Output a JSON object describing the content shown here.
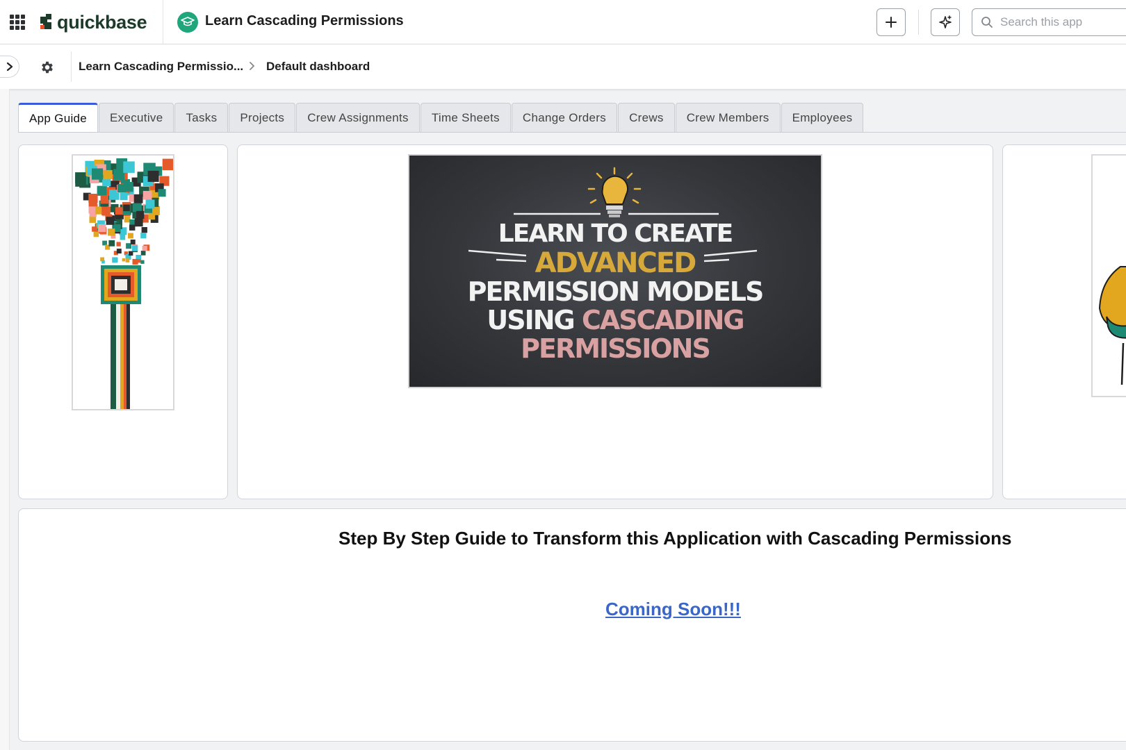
{
  "header": {
    "logo_text": "quickbase",
    "app_title": "Learn Cascading Permissions",
    "search_placeholder": "Search this app"
  },
  "breadcrumb": {
    "app": "Learn Cascading Permissio...",
    "page": "Default dashboard"
  },
  "tabs": [
    {
      "label": "App Guide",
      "active": true
    },
    {
      "label": "Executive"
    },
    {
      "label": "Tasks"
    },
    {
      "label": "Projects"
    },
    {
      "label": "Crew Assignments"
    },
    {
      "label": "Time Sheets"
    },
    {
      "label": "Change Orders"
    },
    {
      "label": "Crews"
    },
    {
      "label": "Crew Members"
    },
    {
      "label": "Employees"
    }
  ],
  "banner": {
    "line1": "LEARN TO CREATE",
    "line2": "ADVANCED",
    "line3": "PERMISSION MODELS",
    "line4a": "USING",
    "line4b": "CASCADING",
    "line5": "PERMISSIONS"
  },
  "guide": {
    "title": "Step By Step Guide to Transform this Application with Cascading Permissions",
    "link": "Coming Soon!!!"
  },
  "colors": {
    "accent": "#3b5bdb",
    "brand_green": "#1fa67a",
    "link": "#3a66c8"
  }
}
